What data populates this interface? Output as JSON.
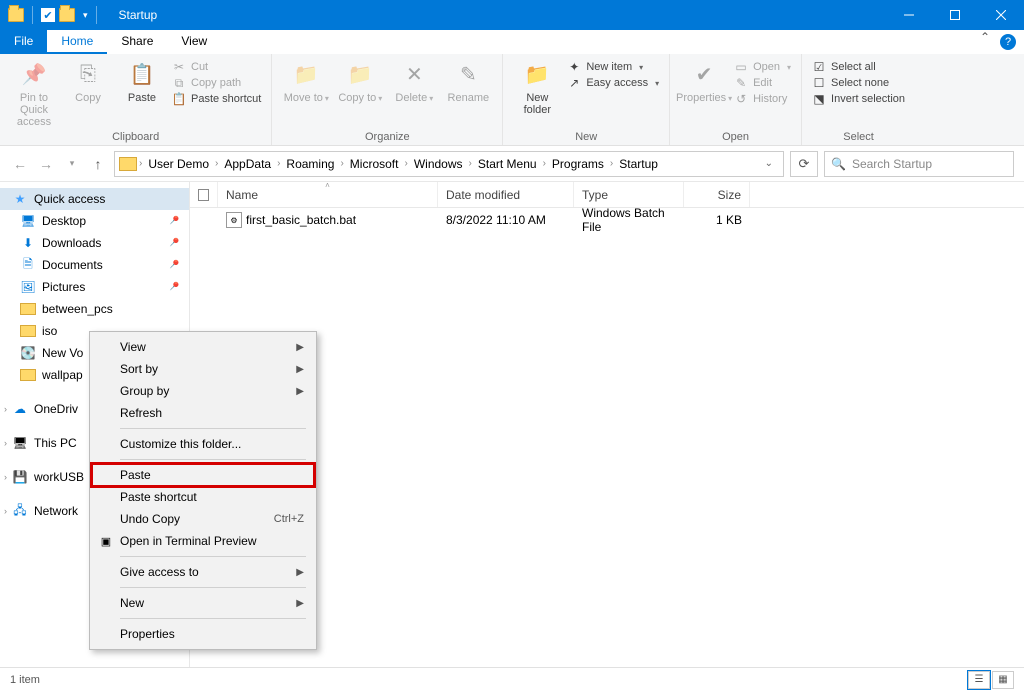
{
  "window": {
    "title": "Startup"
  },
  "tabs": {
    "file": "File",
    "home": "Home",
    "share": "Share",
    "view": "View"
  },
  "ribbon": {
    "clipboard": {
      "label": "Clipboard",
      "pin": "Pin to Quick access",
      "copy": "Copy",
      "paste": "Paste",
      "cut": "Cut",
      "copy_path": "Copy path",
      "paste_shortcut": "Paste shortcut"
    },
    "organize": {
      "label": "Organize",
      "move_to": "Move to",
      "copy_to": "Copy to",
      "delete": "Delete",
      "rename": "Rename"
    },
    "new": {
      "label": "New",
      "new_folder": "New folder",
      "new_item": "New item",
      "easy_access": "Easy access"
    },
    "open": {
      "label": "Open",
      "properties": "Properties",
      "open": "Open",
      "edit": "Edit",
      "history": "History"
    },
    "select": {
      "label": "Select",
      "select_all": "Select all",
      "select_none": "Select none",
      "invert": "Invert selection"
    }
  },
  "breadcrumb": {
    "items": [
      "User Demo",
      "AppData",
      "Roaming",
      "Microsoft",
      "Windows",
      "Start Menu",
      "Programs",
      "Startup"
    ]
  },
  "search": {
    "placeholder": "Search Startup"
  },
  "columns": {
    "name": "Name",
    "date": "Date modified",
    "type": "Type",
    "size": "Size"
  },
  "files": [
    {
      "name": "first_basic_batch.bat",
      "date": "8/3/2022 11:10 AM",
      "type": "Windows Batch File",
      "size": "1 KB"
    }
  ],
  "sidebar": {
    "quick_access": "Quick access",
    "desktop": "Desktop",
    "downloads": "Downloads",
    "documents": "Documents",
    "pictures": "Pictures",
    "between_pcs": "between_pcs",
    "iso": "iso",
    "new_vo": "New Vo",
    "wallpap": "wallpap",
    "onedrive": "OneDriv",
    "this_pc": "This PC",
    "workusb": "workUSB",
    "network": "Network"
  },
  "context_menu": {
    "view": "View",
    "sort_by": "Sort by",
    "group_by": "Group by",
    "refresh": "Refresh",
    "customize": "Customize this folder...",
    "paste": "Paste",
    "paste_shortcut": "Paste shortcut",
    "undo_copy": "Undo Copy",
    "undo_shortcut": "Ctrl+Z",
    "open_terminal": "Open in Terminal Preview",
    "give_access": "Give access to",
    "new": "New",
    "properties": "Properties"
  },
  "status": {
    "item_count": "1 item"
  }
}
